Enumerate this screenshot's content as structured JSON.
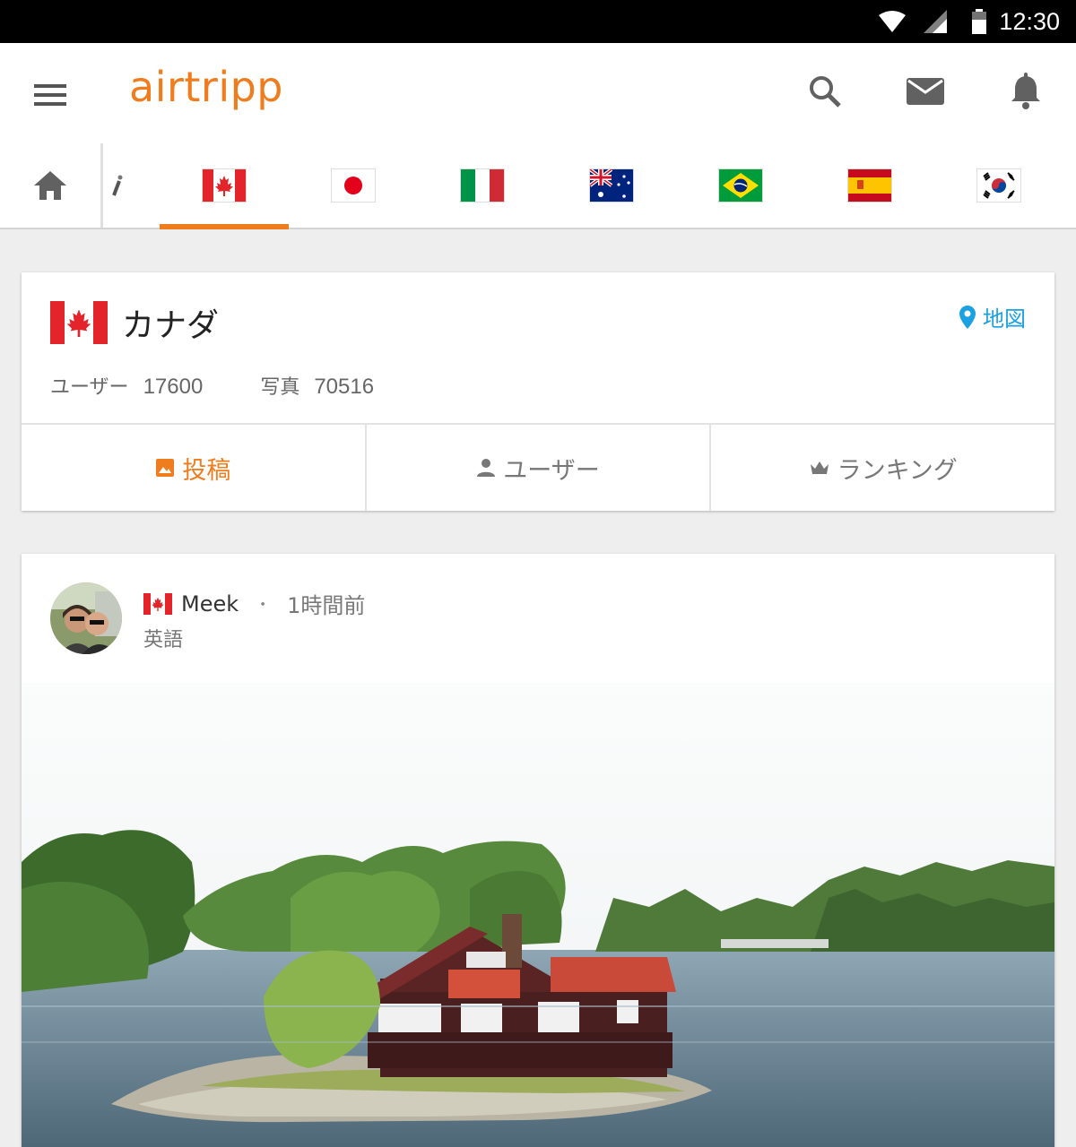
{
  "status_bar": {
    "time": "12:30",
    "icons": [
      "wifi-icon",
      "signal-icon",
      "battery-icon"
    ]
  },
  "app_bar": {
    "logo": "airtripp",
    "brand_color": "#ef7d1e",
    "actions": [
      "search-icon",
      "mail-icon",
      "bell-icon"
    ]
  },
  "country_tabs": {
    "items": [
      "home",
      "partial-flag",
      "canada",
      "japan",
      "italy",
      "australia",
      "brazil",
      "spain",
      "south-korea"
    ],
    "selected": "canada"
  },
  "country": {
    "name": "カナダ",
    "map_label": "地図",
    "users_label": "ユーザー",
    "users_count": "17600",
    "photos_label": "写真",
    "photos_count": "70516"
  },
  "card_tabs": [
    {
      "label": "投稿",
      "icon": "image-icon",
      "active": true
    },
    {
      "label": "ユーザー",
      "icon": "person-icon",
      "active": false
    },
    {
      "label": "ランキング",
      "icon": "crown-icon",
      "active": false
    }
  ],
  "post": {
    "author": "Meek",
    "time_ago": "1時間前",
    "separator": "・",
    "language": "英語"
  },
  "colors": {
    "accent": "#ef7d1e",
    "link": "#1ba1e2"
  }
}
